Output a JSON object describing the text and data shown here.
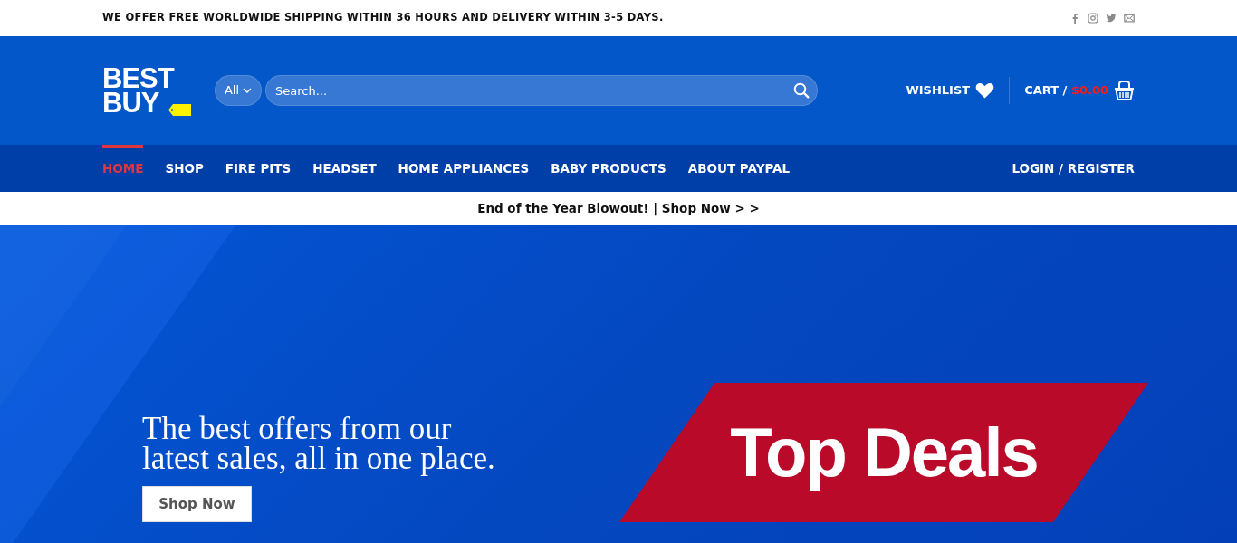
{
  "top_bar": {
    "message": "WE OFFER FREE WORLDWIDE SHIPPING WITHIN 36 HOURS AND DELIVERY WITHIN 3-5 DAYS.",
    "social": [
      {
        "kind": "facebook"
      },
      {
        "kind": "instagram"
      },
      {
        "kind": "twitter"
      },
      {
        "kind": "email"
      }
    ]
  },
  "header": {
    "logo": {
      "line_1": "BEST",
      "line_2": "BUY"
    },
    "category": "All",
    "search": {
      "placeholder": "Search..."
    },
    "wishlist": "WISHLIST",
    "cart": {
      "label": "CART /",
      "amount": "$0.00"
    }
  },
  "nav": {
    "items": [
      {
        "label": "HOME",
        "selected": true
      },
      {
        "label": "SHOP",
        "selected": false
      },
      {
        "label": "FIRE PITS",
        "selected": false
      },
      {
        "label": "HEADSET",
        "selected": false
      },
      {
        "label": "HOME APPLIANCES",
        "selected": false
      },
      {
        "label": "BABY PRODUCTS",
        "selected": false
      },
      {
        "label": "ABOUT PAYPAL",
        "selected": false
      }
    ],
    "account": "LOGIN / REGISTER"
  },
  "promo_bar": "End of the Year Blowout! | Shop Now > >",
  "hero": {
    "headline": "The best offers from our latest sales, all in one place.",
    "button": "Shop Now",
    "banner": "Top Deals"
  }
}
